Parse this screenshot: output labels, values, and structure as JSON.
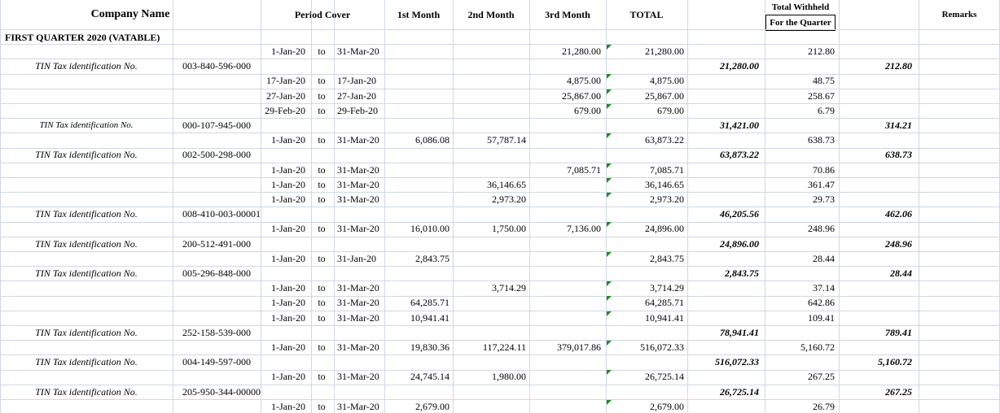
{
  "headers": {
    "company_name": "Company Name",
    "period_cover": "Period Cover",
    "first_month": "1st Month",
    "second_month": "2nd Month",
    "third_month": "3rd Month",
    "total": "TOTAL",
    "total_withheld_line1": "Total Withheld",
    "total_withheld_line2": "For the Quarter",
    "remarks": "Remarks"
  },
  "section_title": "FIRST QUARTER 2020 (VATABLE)",
  "to_word": "to",
  "rows": [
    {
      "type": "detail",
      "from": "1-Jan-20",
      "to": "31-Mar-20",
      "m1": "",
      "m2": "",
      "m3": "21,280.00",
      "total": "21,280.00",
      "withheld": "212.80",
      "flag": true
    },
    {
      "type": "tin",
      "label": "TIN Tax identification No.",
      "tin": "003-840-596-000",
      "quarter_total": "21,280.00",
      "remarks": "212.80"
    },
    {
      "type": "detail",
      "from": "17-Jan-20",
      "to": "17-Jan-20",
      "m1": "",
      "m2": "",
      "m3": "4,875.00",
      "total": "4,875.00",
      "withheld": "48.75",
      "flag": true
    },
    {
      "type": "detail",
      "from": "27-Jan-20",
      "to": "27-Jan-20",
      "m1": "",
      "m2": "",
      "m3": "25,867.00",
      "total": "25,867.00",
      "withheld": "258.67",
      "flag": true
    },
    {
      "type": "detail",
      "from": "29-Feb-20",
      "to": "29-Feb-20",
      "m1": "",
      "m2": "",
      "m3": "679.00",
      "total": "679.00",
      "withheld": "6.79",
      "flag": true
    },
    {
      "type": "tin",
      "label": "TIN Tax identification No.",
      "tin": "000-107-945-000",
      "quarter_total": "31,421.00",
      "remarks": "314.21",
      "small": true
    },
    {
      "type": "detail",
      "from": "1-Jan-20",
      "to": "31-Mar-20",
      "m1": "6,086.08",
      "m2": "57,787.14",
      "m3": "",
      "total": "63,873.22",
      "withheld": "638.73",
      "flag": true
    },
    {
      "type": "tin",
      "label": "TIN Tax identification No.",
      "tin": "002-500-298-000",
      "quarter_total": "63,873.22",
      "remarks": "638.73"
    },
    {
      "type": "detail",
      "from": "1-Jan-20",
      "to": "31-Mar-20",
      "m1": "",
      "m2": "",
      "m3": "7,085.71",
      "total": "7,085.71",
      "withheld": "70.86",
      "flag": true
    },
    {
      "type": "detail",
      "from": "1-Jan-20",
      "to": "31-Mar-20",
      "m1": "",
      "m2": "36,146.65",
      "m3": "",
      "total": "36,146.65",
      "withheld": "361.47",
      "flag": true
    },
    {
      "type": "detail",
      "from": "1-Jan-20",
      "to": "31-Mar-20",
      "m1": "",
      "m2": "2,973.20",
      "m3": "",
      "total": "2,973.20",
      "withheld": "29.73",
      "flag": true
    },
    {
      "type": "tin",
      "label": "TIN Tax identification No.",
      "tin": "008-410-003-00001",
      "quarter_total": "46,205.56",
      "remarks": "462.06"
    },
    {
      "type": "detail",
      "from": "1-Jan-20",
      "to": "31-Mar-20",
      "m1": "16,010.00",
      "m2": "1,750.00",
      "m3": "7,136.00",
      "total": "24,896.00",
      "withheld": "248.96",
      "flag": true
    },
    {
      "type": "tin",
      "label": "TIN Tax identification No.",
      "tin": "200-512-491-000",
      "quarter_total": "24,896.00",
      "remarks": "248.96"
    },
    {
      "type": "detail",
      "from": "1-Jan-20",
      "to": "31-Jan-20",
      "m1": "2,843.75",
      "m2": "",
      "m3": "",
      "total": "2,843.75",
      "withheld": "28.44",
      "flag": true
    },
    {
      "type": "tin",
      "label": "TIN Tax identification No.",
      "tin": "005-296-848-000",
      "quarter_total": "2,843.75",
      "remarks": "28.44"
    },
    {
      "type": "detail",
      "from": "1-Jan-20",
      "to": "31-Mar-20",
      "m1": "",
      "m2": "3,714.29",
      "m3": "",
      "total": "3,714.29",
      "withheld": "37.14",
      "flag": true
    },
    {
      "type": "detail",
      "from": "1-Jan-20",
      "to": "31-Mar-20",
      "m1": "64,285.71",
      "m2": "",
      "m3": "",
      "total": "64,285.71",
      "withheld": "642.86",
      "flag": true
    },
    {
      "type": "detail",
      "from": "1-Jan-20",
      "to": "31-Mar-20",
      "m1": "10,941.41",
      "m2": "",
      "m3": "",
      "total": "10,941.41",
      "withheld": "109.41",
      "flag": true
    },
    {
      "type": "tin",
      "label": "TIN Tax identification No.",
      "tin": "252-158-539-000",
      "quarter_total": "78,941.41",
      "remarks": "789.41"
    },
    {
      "type": "detail",
      "from": "1-Jan-20",
      "to": "31-Mar-20",
      "m1": "19,830.36",
      "m2": "117,224.11",
      "m3": "379,017.86",
      "total": "516,072.33",
      "withheld": "5,160.72",
      "flag": true
    },
    {
      "type": "tin",
      "label": "TIN Tax identification No.",
      "tin": "004-149-597-000",
      "quarter_total": "516,072.33",
      "remarks": "5,160.72"
    },
    {
      "type": "detail",
      "from": "1-Jan-20",
      "to": "31-Mar-20",
      "m1": "24,745.14",
      "m2": "1,980.00",
      "m3": "",
      "total": "26,725.14",
      "withheld": "267.25",
      "flag": true
    },
    {
      "type": "tin",
      "label": "TIN Tax identification No.",
      "tin": "205-950-344-00000",
      "quarter_total": "26,725.14",
      "remarks": "267.25"
    },
    {
      "type": "detail",
      "from": "1-Jan-20",
      "to": "31-Mar-20",
      "m1": "2,679.00",
      "m2": "",
      "m3": "",
      "total": "2,679.00",
      "withheld": "26.79",
      "flag": true
    }
  ],
  "colors": {
    "gridline": "#d0d7e5",
    "flag_triangle": "#1e8c1e",
    "text": "#000000"
  }
}
